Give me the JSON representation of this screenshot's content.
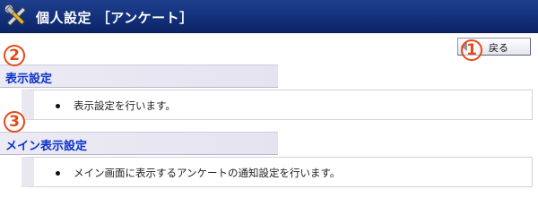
{
  "header": {
    "title": "個人設定 ［アンケート］",
    "icon": "tools-icon"
  },
  "back_button": {
    "label": "戻る",
    "icon": "left-arrow-icon"
  },
  "callouts": [
    "1",
    "2",
    "3"
  ],
  "sections": [
    {
      "title": "表示設定",
      "items": [
        "表示設定を行います。"
      ]
    },
    {
      "title": "メイン表示設定",
      "items": [
        "メイン画面に表示するアンケートの通知設定を行います。"
      ]
    }
  ],
  "colors": {
    "title_bar": "#13307a",
    "section_title": "#0b33c9",
    "callout": "#e24a1a",
    "section_header_bg": "#e5e3f0"
  }
}
